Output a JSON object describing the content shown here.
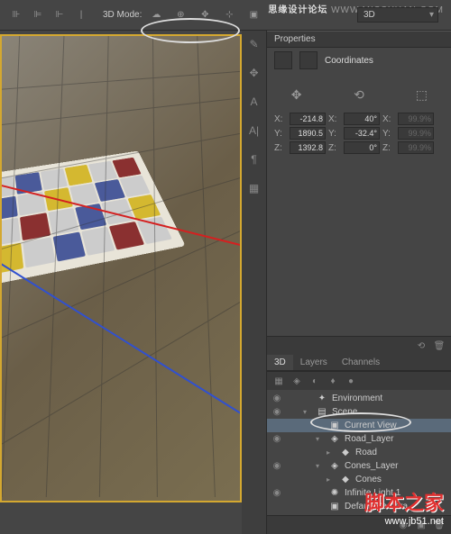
{
  "watermark_top": {
    "part1": "思缘设计论坛",
    "part2": "WWW.MISSYUAN.COM"
  },
  "watermark_bottom": {
    "cn": "脚本之家",
    "url": "www.jb51.net"
  },
  "toolbar": {
    "mode_label": "3D Mode:",
    "dropdown": "3D"
  },
  "panels": {
    "properties_tab": "Properties",
    "coordinates_title": "Coordinates",
    "coords": {
      "x1": "-214.8",
      "x1l": "X:",
      "x2": "40°",
      "x2l": "X:",
      "x3": "99.9%",
      "x3l": "X:",
      "y1": "1890.5",
      "y1l": "Y:",
      "y2": "-32.4°",
      "y2l": "Y:",
      "y3": "99.9%",
      "y3l": "Y:",
      "z1": "1392.8",
      "z1l": "Z:",
      "z2": "0°",
      "z2l": "Z:",
      "z3": "99.9%",
      "z3l": "Z:"
    },
    "tabs": {
      "t1": "3D",
      "t2": "Layers",
      "t3": "Channels"
    },
    "tree": [
      {
        "label": "Environment",
        "icon": "✦",
        "eye": "◉",
        "ind": 1
      },
      {
        "label": "Scene",
        "icon": "▤",
        "eye": "◉",
        "ind": 1,
        "twist": "▾"
      },
      {
        "label": "Current View",
        "icon": "▣",
        "ind": 2,
        "sel": true
      },
      {
        "label": "Road_Layer",
        "icon": "◈",
        "eye": "◉",
        "ind": 2,
        "twist": "▾"
      },
      {
        "label": "Road",
        "icon": "◆",
        "ind": 3,
        "twist": "▸"
      },
      {
        "label": "Cones_Layer",
        "icon": "◈",
        "eye": "◉",
        "ind": 2,
        "twist": "▾"
      },
      {
        "label": "Cones",
        "icon": "◆",
        "ind": 3,
        "twist": "▸"
      },
      {
        "label": "Infinite Light 1",
        "icon": "✺",
        "eye": "◉",
        "ind": 2
      },
      {
        "label": "Default Camera",
        "icon": "▣",
        "ind": 2
      }
    ]
  }
}
